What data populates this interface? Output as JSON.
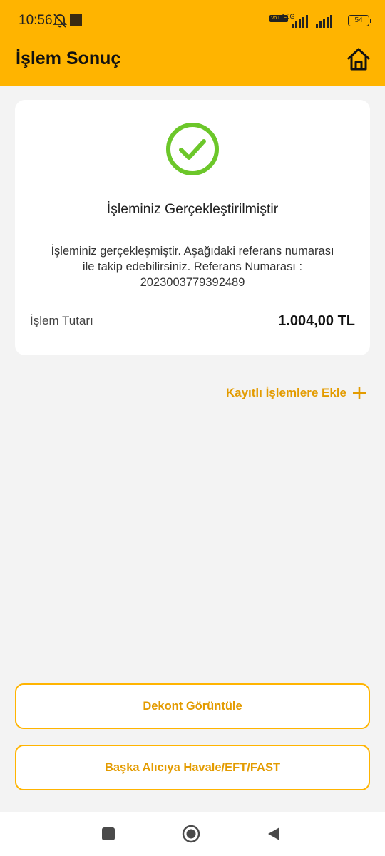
{
  "status_bar": {
    "time": "10:56",
    "network_type": "4.5G",
    "volte": "Vo LTE",
    "battery": "54"
  },
  "header": {
    "title": "İşlem Sonuç",
    "background_color": "#ffb400"
  },
  "result": {
    "title": "İşleminiz Gerçekleştirilmiştir",
    "message": "İşleminiz gerçekleşmiştir. Aşağıdaki referans numarası ile takip edebilirsiniz. Referans Numarası : 2023003779392489",
    "amount_label": "İşlem Tutarı",
    "amount_value": "1.004,00 TL",
    "success_color": "#6cc72a"
  },
  "actions": {
    "add_to_saved_label": "Kayıtlı İşlemlere Ekle",
    "view_receipt_label": "Dekont Görüntüle",
    "transfer_again_label": "Başka Alıcıya Havale/EFT/FAST",
    "accent_color": "#e39b00"
  },
  "icons": {
    "home": "home-icon",
    "success": "check-circle-icon",
    "add": "plus-icon"
  }
}
